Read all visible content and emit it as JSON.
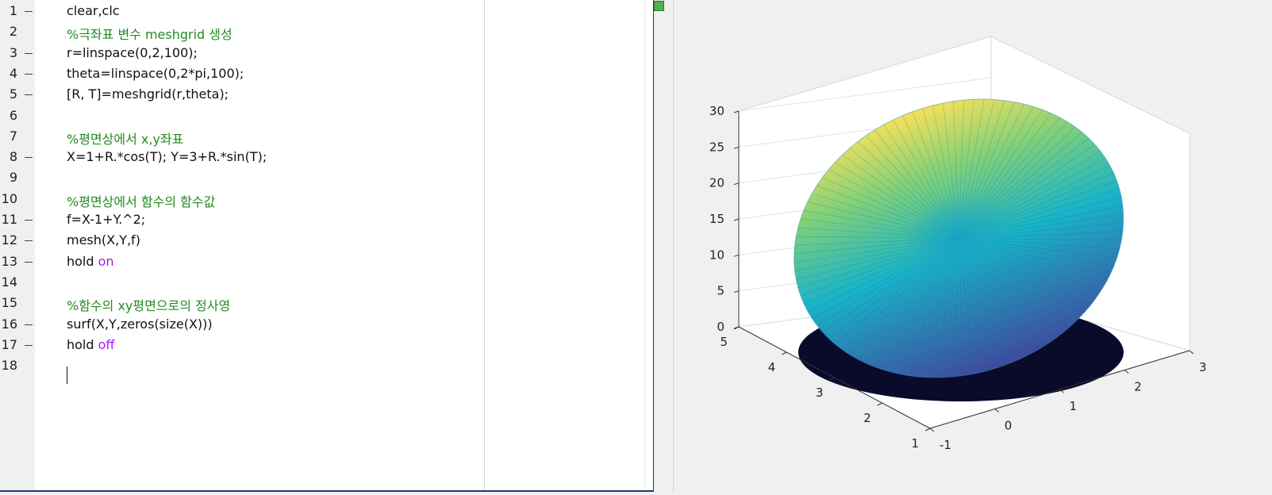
{
  "editor": {
    "lines": [
      {
        "num": "1",
        "has_marker": true,
        "parts": [
          {
            "t": "clear,clc",
            "c": "code"
          }
        ]
      },
      {
        "num": "2",
        "has_marker": false,
        "parts": [
          {
            "t": "%극좌표 변수 meshgrid 생성",
            "c": "cmt"
          }
        ]
      },
      {
        "num": "3",
        "has_marker": true,
        "parts": [
          {
            "t": "r=linspace(0,2,100);",
            "c": "code"
          }
        ]
      },
      {
        "num": "4",
        "has_marker": true,
        "parts": [
          {
            "t": "theta=linspace(0,2*pi,100);",
            "c": "code"
          }
        ]
      },
      {
        "num": "5",
        "has_marker": true,
        "parts": [
          {
            "t": "[R, T]=meshgrid(r,theta);",
            "c": "code"
          }
        ]
      },
      {
        "num": "6",
        "has_marker": false,
        "parts": []
      },
      {
        "num": "7",
        "has_marker": false,
        "parts": [
          {
            "t": "%평면상에서 x,y좌표",
            "c": "cmt"
          }
        ]
      },
      {
        "num": "8",
        "has_marker": true,
        "parts": [
          {
            "t": "X=1+R.*cos(T); Y=3+R.*sin(T);",
            "c": "code"
          }
        ]
      },
      {
        "num": "9",
        "has_marker": false,
        "parts": []
      },
      {
        "num": "10",
        "has_marker": false,
        "parts": [
          {
            "t": "%평면상에서 함수의 함수값",
            "c": "cmt"
          }
        ]
      },
      {
        "num": "11",
        "has_marker": true,
        "parts": [
          {
            "t": "f=X-1+Y.^2;",
            "c": "code"
          }
        ]
      },
      {
        "num": "12",
        "has_marker": true,
        "parts": [
          {
            "t": "mesh(X,Y,f)",
            "c": "code"
          }
        ]
      },
      {
        "num": "13",
        "has_marker": true,
        "parts": [
          {
            "t": "hold ",
            "c": "code"
          },
          {
            "t": "on",
            "c": "kw"
          }
        ]
      },
      {
        "num": "14",
        "has_marker": false,
        "parts": []
      },
      {
        "num": "15",
        "has_marker": false,
        "parts": [
          {
            "t": "%함수의 xy평면으로의 정사영",
            "c": "cmt"
          }
        ]
      },
      {
        "num": "16",
        "has_marker": true,
        "parts": [
          {
            "t": "surf(X,Y,zeros(size(X)))",
            "c": "code"
          }
        ]
      },
      {
        "num": "17",
        "has_marker": true,
        "parts": [
          {
            "t": "hold ",
            "c": "code"
          },
          {
            "t": "off",
            "c": "kw"
          }
        ]
      },
      {
        "num": "18",
        "has_marker": false,
        "parts": []
      }
    ],
    "colors": {
      "comment": "#228b22",
      "keyword": "#a020f0",
      "code": "#111111"
    }
  },
  "figure": {
    "z_ticks": [
      "0",
      "5",
      "10",
      "15",
      "20",
      "25",
      "30"
    ],
    "y_ticks": [
      "1",
      "2",
      "3",
      "4",
      "5"
    ],
    "x_ticks": [
      "-1",
      "0",
      "1",
      "2",
      "3"
    ],
    "colors": {
      "surface_low": "#3f4a9e",
      "surface_mid": "#19b3c9",
      "surface_high": "#f5e05a",
      "projection": "#0a0a2a"
    }
  }
}
